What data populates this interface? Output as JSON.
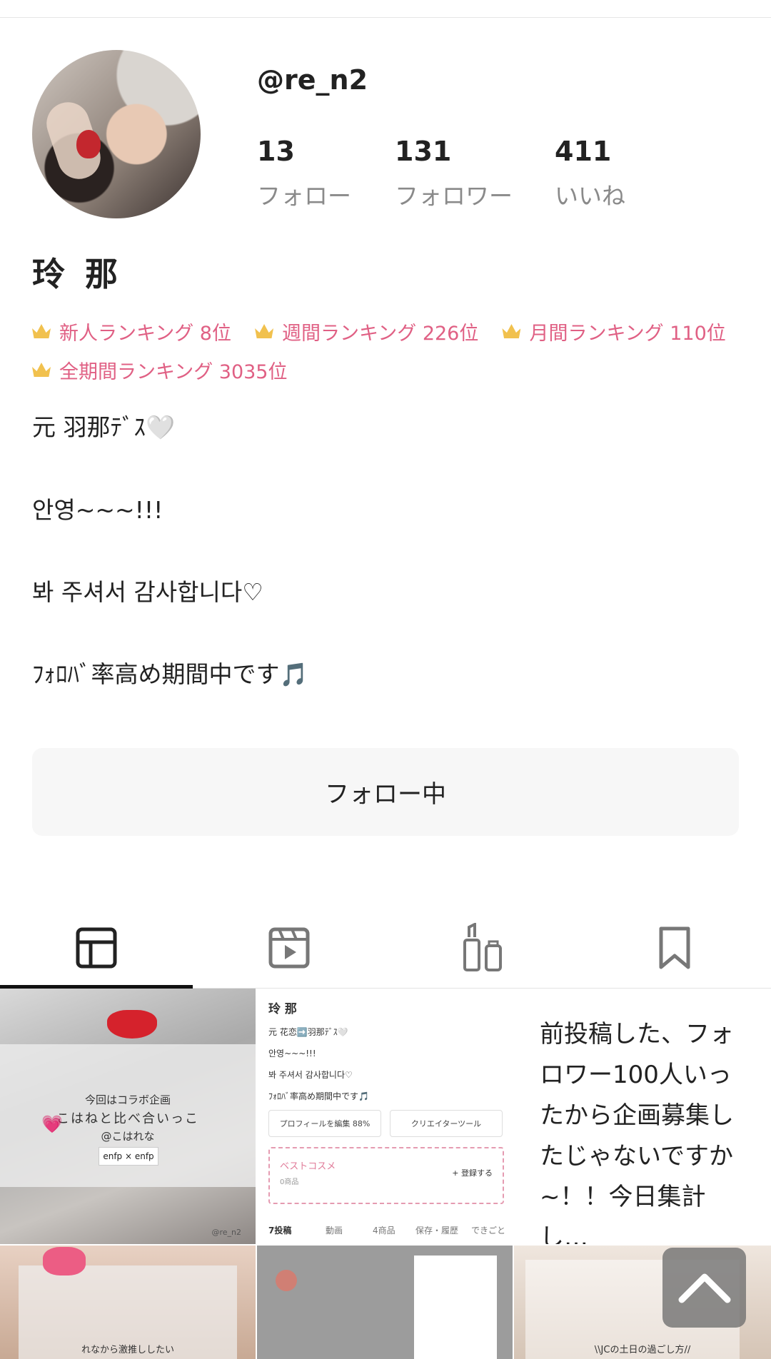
{
  "profile": {
    "handle": "@re_n2",
    "display_name": "玲 那",
    "stats": [
      {
        "value": "13",
        "label": "フォロー"
      },
      {
        "value": "131",
        "label": "フォロワー"
      },
      {
        "value": "411",
        "label": "いいね"
      }
    ],
    "rankings": [
      "新人ランキング 8位",
      "週間ランキング 226位",
      "月間ランキング 110位",
      "全期間ランキング 3035位"
    ],
    "bio": [
      "元 羽那ﾃﾞｽ🤍",
      "안영~~~!!!",
      "봐 주셔서 감사합니다♡",
      "ﾌｫﾛﾊﾞ率高め期間中です"
    ],
    "bio_note_icon": "🎵",
    "follow_button_label": "フォロー中"
  },
  "tabs": [
    {
      "name": "posts",
      "icon": "grid-layout-icon",
      "active": true
    },
    {
      "name": "videos",
      "icon": "video-play-icon",
      "active": false
    },
    {
      "name": "cosmetics",
      "icon": "cosmetics-icon",
      "active": false
    },
    {
      "name": "saved",
      "icon": "bookmark-icon",
      "active": false
    }
  ],
  "posts": {
    "post1": {
      "line1": "今回はコラボ企画",
      "line2": "こはねと比べ合いっこ",
      "line3": "@こはれな",
      "tag": "enfp × enfp",
      "corner": "@re_n2"
    },
    "post2": {
      "name": "玲 那",
      "bio": [
        "元 花恋➡️羽那ﾃﾞｽ🤍",
        "안영~~~!!!",
        "봐 주셔서 감사합니다♡",
        "ﾌｫﾛﾊﾞ率高め期間中です🎵"
      ],
      "edit_btn": "プロフィールを編集 88%",
      "creator_btn": "クリエイターツール",
      "best_cosme": "ベストコスメ",
      "item_count": "0商品",
      "register": "+ 登録する",
      "tabs": [
        "7投稿",
        "動画",
        "4商品",
        "保存・履歴",
        "できごと"
      ]
    },
    "post3": {
      "text": "前投稿した、フォロワー100人いったから企画募集したじゃないですか~！！今日集計し…"
    },
    "post4": {
      "text": "れなから激推ししたい"
    },
    "post6": {
      "text": "\\\\JCの土日の過ごし方//"
    }
  },
  "colors": {
    "ranking": "#e06084",
    "crown": "#f1c14e",
    "follow_button_bg": "#f7f7f7",
    "tab_indicator": "#111111"
  }
}
